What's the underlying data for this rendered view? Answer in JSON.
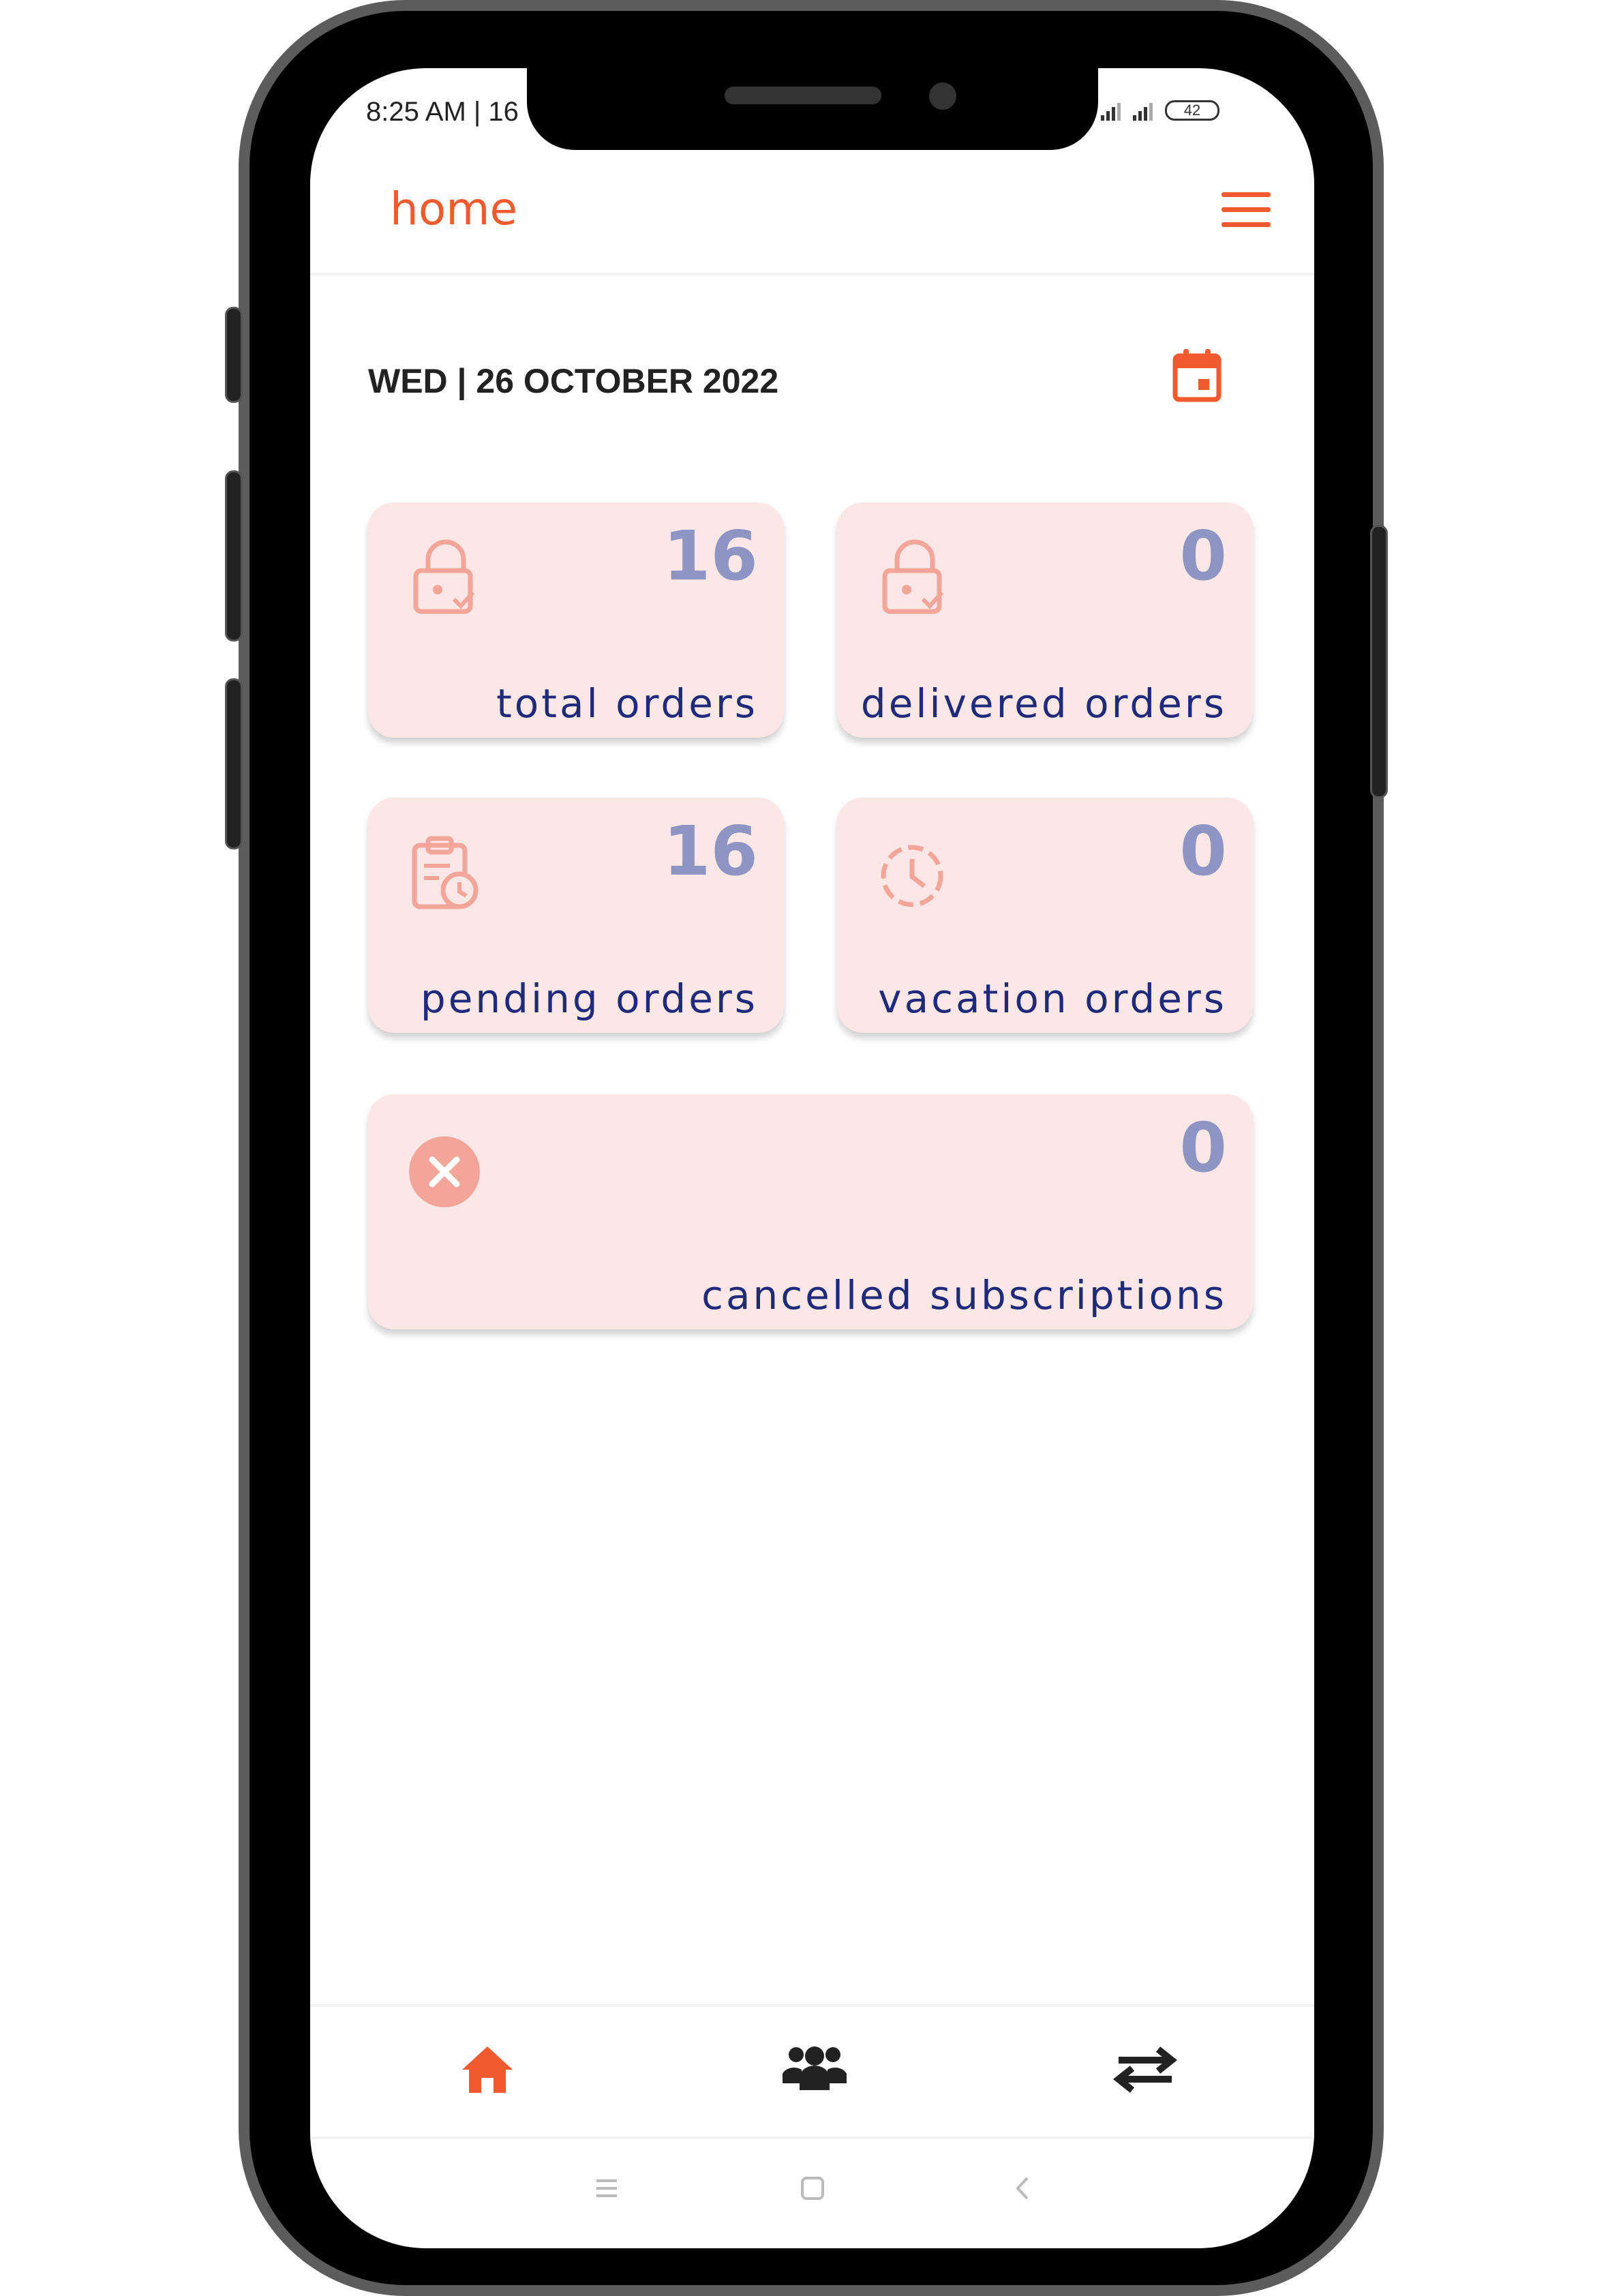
{
  "status_bar": {
    "time": "8:25 AM | 16",
    "battery": "42"
  },
  "header": {
    "title": "home"
  },
  "date": {
    "text": "WED | 26 OCTOBER 2022"
  },
  "cards": [
    {
      "count": "16",
      "label": "total orders",
      "icon": "lock-check-icon"
    },
    {
      "count": "0",
      "label": "delivered orders",
      "icon": "lock-check-icon"
    },
    {
      "count": "16",
      "label": "pending orders",
      "icon": "clipboard-clock-icon"
    },
    {
      "count": "0",
      "label": "vacation orders",
      "icon": "clock-dashed-icon"
    },
    {
      "count": "0",
      "label": "cancelled subscriptions",
      "icon": "cancel-circle-icon"
    }
  ],
  "bottom_nav": [
    {
      "icon": "home-icon",
      "active": true
    },
    {
      "icon": "users-icon",
      "active": false
    },
    {
      "icon": "swap-arrows-icon",
      "active": false
    }
  ],
  "colors": {
    "accent": "#f05a2e",
    "card_bg": "#fbe7e5",
    "count": "#8f95c2",
    "label": "#1f2a7a"
  }
}
